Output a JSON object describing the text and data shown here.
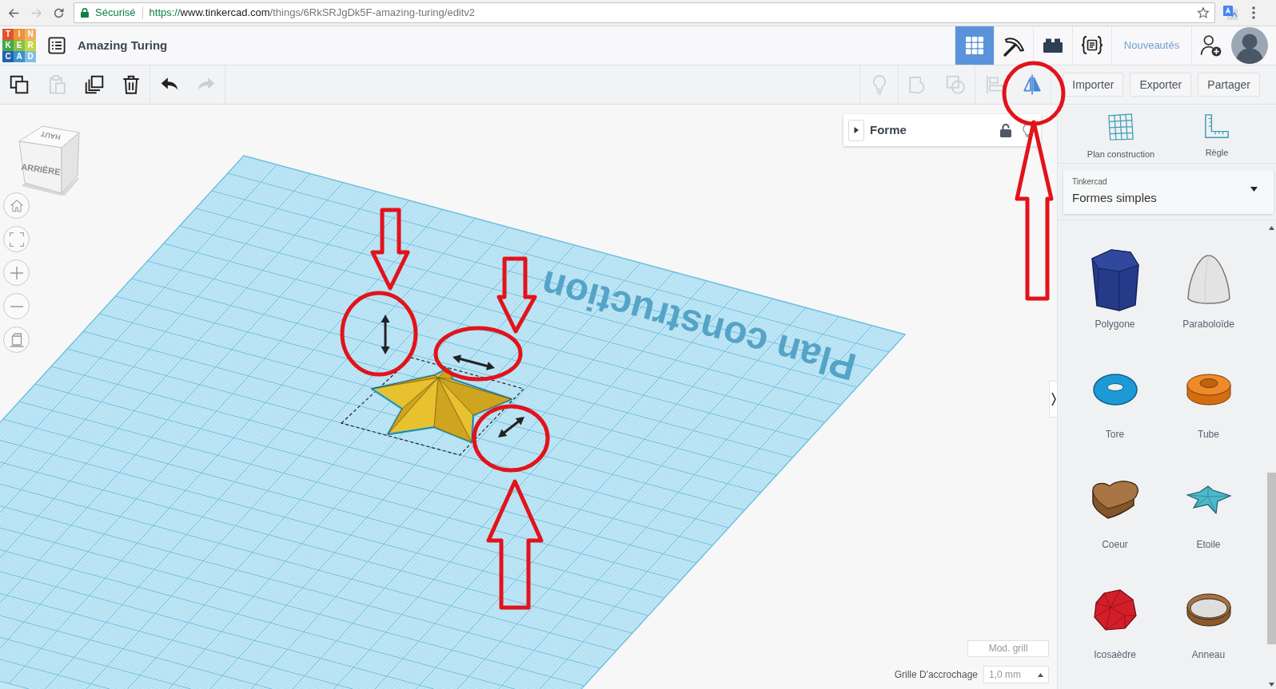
{
  "browser": {
    "nav": [
      {
        "kind": "back",
        "disabled": false
      },
      {
        "kind": "forward",
        "disabled": true
      },
      {
        "kind": "reload",
        "disabled": false
      }
    ],
    "security": "Sécurisé",
    "url": {
      "scheme": "https://",
      "host": "www.tinkercad.com",
      "path": "/things/6RkSRJgDk5F-amazing-turing/editv2"
    }
  },
  "header": {
    "logo_tiles": [
      {
        "letter": "T",
        "color": "#e4532f"
      },
      {
        "letter": "I",
        "color": "#f0913a"
      },
      {
        "letter": "N",
        "color": "#f3ae6b"
      },
      {
        "letter": "K",
        "color": "#45a849"
      },
      {
        "letter": "E",
        "color": "#86c144"
      },
      {
        "letter": "R",
        "color": "#c2d843"
      },
      {
        "letter": "C",
        "color": "#1f64ad"
      },
      {
        "letter": "A",
        "color": "#3d92d4"
      },
      {
        "letter": "D",
        "color": "#84bde5"
      }
    ],
    "title": "Amazing Turing",
    "views": [
      {
        "kind": "grid",
        "selected": true
      },
      {
        "kind": "pickaxe",
        "selected": false
      },
      {
        "kind": "bricks",
        "selected": false
      },
      {
        "kind": "code",
        "selected": false
      }
    ],
    "news": "Nouveautés"
  },
  "toolbar": {
    "edit_tools": [
      {
        "kind": "copy",
        "disabled": false
      },
      {
        "kind": "paste",
        "disabled": true
      },
      {
        "kind": "duplicate",
        "disabled": false
      },
      {
        "kind": "delete",
        "disabled": false
      },
      {
        "kind": "undo",
        "disabled": false
      },
      {
        "kind": "redo",
        "disabled": true
      }
    ],
    "shape_tools": [
      {
        "kind": "light",
        "disabled": true
      },
      {
        "kind": "group",
        "disabled": true
      },
      {
        "kind": "ungroup",
        "disabled": true
      },
      {
        "kind": "align",
        "disabled": true
      },
      {
        "kind": "mirror",
        "disabled": false
      }
    ],
    "buttons": [
      "Importer",
      "Exporter",
      "Partager"
    ]
  },
  "canvas": {
    "view_cube": {
      "front": "ARRIÈRE",
      "top": "HAUT"
    },
    "view_controls": [
      {
        "kind": "home"
      },
      {
        "kind": "fit"
      },
      {
        "kind": "zoom_in"
      },
      {
        "kind": "zoom_out"
      },
      {
        "kind": "ortho"
      }
    ],
    "workplane_label": "Plan construction",
    "shape_panel": {
      "title": "Forme",
      "expanded": false,
      "locked": false
    },
    "grid_button": "Mod. grill",
    "snap_grid": {
      "label": "Grille D'accrochage",
      "value": "1,0 mm"
    }
  },
  "panel": {
    "tools": [
      {
        "kind": "workplane",
        "label": "Plan construction"
      },
      {
        "kind": "ruler",
        "label": "Règle"
      }
    ],
    "library": {
      "source": "Tinkercad",
      "category": "Formes simples"
    },
    "shapes": [
      {
        "kind": "polygon",
        "label": "Polygone"
      },
      {
        "kind": "paraboloid",
        "label": "Paraboloïde"
      },
      {
        "kind": "torus",
        "label": "Tore"
      },
      {
        "kind": "tube",
        "label": "Tube"
      },
      {
        "kind": "heart",
        "label": "Coeur"
      },
      {
        "kind": "star",
        "label": "Etoile"
      },
      {
        "kind": "icosahedron",
        "label": "Icosaèdre"
      },
      {
        "kind": "ring",
        "label": "Anneau"
      }
    ]
  }
}
